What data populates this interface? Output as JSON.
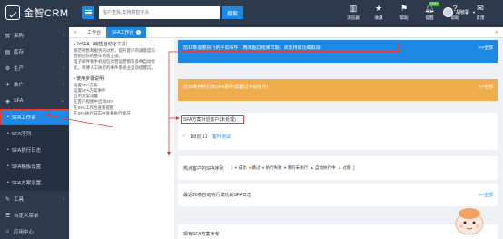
{
  "app": {
    "logo_text": "金智CRM",
    "search_placeholder": "客户查找,支持拼音字头",
    "search_button": "搜索"
  },
  "top_icons": [
    {
      "icon": "chart-icon",
      "label": "浏览器"
    },
    {
      "icon": "star-icon",
      "label": "收藏"
    },
    {
      "icon": "flag-icon",
      "label": "帮助"
    },
    {
      "icon": "bell-icon",
      "label": "提醒",
      "badge": "TEST"
    },
    {
      "icon": "question-icon",
      "label": "帮助"
    },
    {
      "icon": "chat-icon",
      "label": "反馈"
    }
  ],
  "user": {
    "name": "胡敏馨"
  },
  "sidebar": {
    "items": [
      {
        "icon": "cart-icon",
        "label": "采购"
      },
      {
        "icon": "box-icon",
        "label": "库存"
      },
      {
        "icon": "gear-icon",
        "label": "生产"
      },
      {
        "icon": "megaphone-icon",
        "label": "推广"
      },
      {
        "icon": "sfa-icon",
        "label": "SFA"
      }
    ],
    "sub_items": [
      {
        "label": "SFA工作台",
        "active": true
      },
      {
        "label": "SFA序列"
      },
      {
        "label": "SFA执行日志"
      },
      {
        "label": "SFA模板设置"
      },
      {
        "label": "SFA方案设置"
      }
    ],
    "bottom_items": [
      {
        "icon": "wrench-icon",
        "label": "工具"
      },
      {
        "icon": "list-icon",
        "label": "自定义菜单"
      },
      {
        "icon": "home-icon",
        "label": "应用中心"
      }
    ]
  },
  "tabs": {
    "items": [
      {
        "label": "工作台"
      },
      {
        "label": "SFA工作台",
        "active": true
      }
    ]
  },
  "help": {
    "section1_title": "• JzSFA（销售自动化工具）",
    "section1_lines": [
      "规范销售和服务的过程，提升客户的满意度与",
      "营销团队的整体销售业绩。",
      "电子邮件和手机短信的营运营销等多种自动优",
      "化，简便人工执行的事件系统业自动提醒信。"
    ],
    "section2_title": "• 使用步骤说明",
    "section2_lines": [
      "设置SFA方案",
      "设置SFA方案事件",
      "启用方案设置",
      "在客户视图中启动SFA",
      "在SFA工作台查看提醒",
      "在SFA执行日志中查看执行情况"
    ]
  },
  "panels": {
    "p1": {
      "title": "前10条需要执行的手动事件（两未超过结束日期、状态待成功或取消）",
      "more": ">>全部"
    },
    "p2": {
      "title": "前10条待执行的SFA事件(需超过手动事件)",
      "more": ">>全部"
    },
    "p3": {
      "title": "SFA方案对应客户(未处理)",
      "row_prefix": "【目前:1】",
      "row_link": "客叶测试"
    },
    "p4": {
      "title": "热点客户的SFA序列",
      "legend": [
        {
          "color": "#4caf50",
          "label": "成功"
        },
        {
          "color": "#ff9800",
          "label": "跳过"
        },
        {
          "color": "#4caf50",
          "label": "执行失败"
        },
        {
          "color": "#1e88e5",
          "label": "我的未执行"
        },
        {
          "color": "#1e88e5",
          "label": "自动执行中"
        },
        {
          "color": "#ff9800",
          "label": "过期"
        }
      ]
    },
    "p5": {
      "title": "最近20条自动执行成功的SFA日志",
      "more": ">>全部"
    },
    "p6": {
      "title": "现有SFA方案参考"
    }
  }
}
